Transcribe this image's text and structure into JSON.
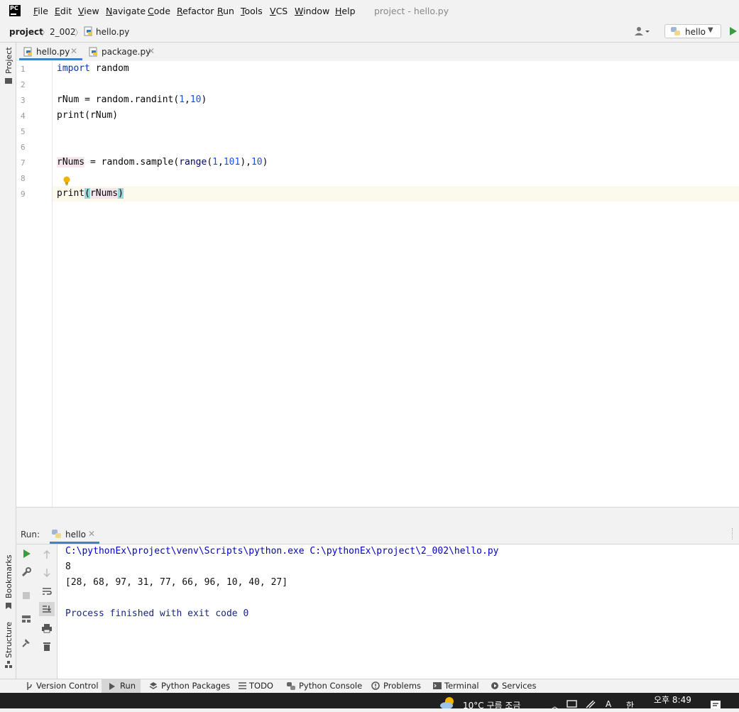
{
  "menu": [
    "File",
    "Edit",
    "View",
    "Navigate",
    "Code",
    "Refactor",
    "Run",
    "Tools",
    "VCS",
    "Window",
    "Help"
  ],
  "window_title": "project - hello.py",
  "logo_text": "PC",
  "breadcrumb": {
    "project": "project",
    "folder": "2_002",
    "file": "hello.py"
  },
  "run_config": {
    "label": "hello"
  },
  "left_strip": {
    "project": "Project",
    "bookmarks": "Bookmarks",
    "structure": "Structure"
  },
  "tabs": [
    {
      "label": "hello.py",
      "active": true
    },
    {
      "label": "package.py",
      "active": false
    }
  ],
  "editor": {
    "line_numbers": [
      "1",
      "2",
      "3",
      "4",
      "5",
      "6",
      "7",
      "8",
      "9"
    ],
    "current_line": 9
  },
  "code_tokens": {
    "l1_kw": "import",
    "l1_rest": " random",
    "l3_a": "rNum = random.randint(",
    "l3_n1": "1",
    "l3_c": ",",
    "l3_n2": "10",
    "l3_e": ")",
    "l4": "print(rNum)",
    "l7_id": "rNums",
    "l7_a": " = random.sample(",
    "l7_range": "range",
    "l7_b": "(",
    "l7_n1": "1",
    "l7_c": ",",
    "l7_n2": "101",
    "l7_d": "),",
    "l7_n3": "10",
    "l7_e": ")",
    "l9_a": "print",
    "l9_p1": "(",
    "l9_id": "rNums",
    "l9_p2": ")"
  },
  "run_panel": {
    "title": "Run:",
    "tab_label": "hello",
    "output": {
      "command": "C:\\pythonEx\\project\\venv\\Scripts\\python.exe C:\\pythonEx\\project\\2_002\\hello.py",
      "line1": "8",
      "line2": "[28, 68, 97, 31, 77, 66, 96, 10, 40, 27]",
      "exit": "Process finished with exit code 0"
    }
  },
  "bottom_tools": [
    "Version Control",
    "Run",
    "Python Packages",
    "TODO",
    "Python Console",
    "Problems",
    "Terminal",
    "Services"
  ],
  "taskbar": {
    "weather": "10°C  구름 조금",
    "time": "오후 8:49",
    "ime": "한",
    "font_a": "A"
  },
  "colors": {
    "accent": "#4083c9",
    "run_green": "#3c9b3f",
    "keyword": "#0033b3",
    "number": "#1750eb"
  }
}
